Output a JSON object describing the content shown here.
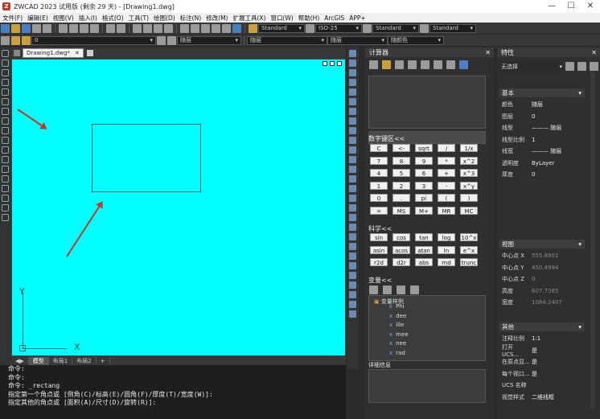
{
  "titlebar": {
    "title": "ZWCAD 2023 试用版 (剩余 29 天) - [Drawing1.dwg]",
    "min": "—",
    "max": "☐",
    "close": "✕"
  },
  "menu": [
    "文件(F)",
    "编辑(E)",
    "视图(V)",
    "插入(I)",
    "格式(O)",
    "工具(T)",
    "绘图(D)",
    "标注(N)",
    "修改(M)",
    "扩展工具(X)",
    "窗口(W)",
    "帮助(H)",
    "ArcGIS",
    "APP+"
  ],
  "toolbar1": {
    "textstyle": "Standard",
    "dimstyle": "ISO-25",
    "tablestyle": "Standard",
    "mlstyle": "Standard"
  },
  "toolbar2": {
    "layer": "0",
    "color": "随层",
    "linetype": "随层",
    "lineweight": "随层",
    "plotstyle": "随颜色"
  },
  "doc": {
    "tab": "Drawing1.dwg*",
    "close": "✕"
  },
  "ucs": {
    "x": "X",
    "y": "Y"
  },
  "layout_tabs": [
    "模型",
    "布局1",
    "布局2",
    "+"
  ],
  "cmd_lines": [
    "命令:",
    "命令:",
    "命令: _rectang",
    "指定第一个角点或 [倒角(C)/标高(E)/圆角(F)/厚度(T)/宽度(W)]:",
    "指定其他的角点或 [面积(A)/尺寸(D)/旋转(R)]:"
  ],
  "calc": {
    "title": "计算器",
    "numpad_title": "数字键区<<",
    "numpad": [
      "C",
      "<-",
      "sqrt",
      "/",
      "1/x",
      "7",
      "8",
      "9",
      "*",
      "x^2",
      "4",
      "5",
      "6",
      "+",
      "x^3",
      "1",
      "2",
      "3",
      "-",
      "x^y",
      "0",
      ".",
      "pi",
      "(",
      ")",
      "=",
      "MS",
      "M+",
      "MR",
      "MC"
    ],
    "sci_title": "科学<<",
    "sci": [
      "sin",
      "cos",
      "tan",
      "log",
      "10^x",
      "asin",
      "acos",
      "atan",
      "ln",
      "e^x",
      "r2d",
      "d2r",
      "abs",
      "rnd",
      "trunc"
    ],
    "vars_title": "变量<<",
    "vars_folder": "变量样例",
    "vars": [
      "Phi",
      "dee",
      "ille",
      "mee",
      "nee",
      "rad"
    ],
    "detail_title": "详细信息"
  },
  "props": {
    "title": "特性",
    "selection": "无选择",
    "groups": {
      "basic": "基本",
      "view": "视图",
      "misc": "其他"
    },
    "basic": [
      [
        "颜色",
        "随层"
      ],
      [
        "图层",
        "0"
      ],
      [
        "线型",
        "——— 随层"
      ],
      [
        "线型比例",
        "1"
      ],
      [
        "线宽",
        "——— 随层"
      ],
      [
        "透明度",
        "ByLayer"
      ],
      [
        "厚度",
        "0"
      ]
    ],
    "view": [
      [
        "中心点 X",
        "555.8901"
      ],
      [
        "中心点 Y",
        "450.4994"
      ],
      [
        "中心点 Z",
        "0"
      ],
      [
        "高度",
        "607.7385"
      ],
      [
        "宽度",
        "1084.2407"
      ]
    ],
    "misc": [
      [
        "注释比例",
        "1:1"
      ],
      [
        "打开 UCS...",
        "是"
      ],
      [
        "在原点显...",
        "是"
      ],
      [
        "每个视口...",
        "是"
      ],
      [
        "UCS 名称",
        ""
      ],
      [
        "视觉样式",
        "二维线框"
      ]
    ]
  }
}
